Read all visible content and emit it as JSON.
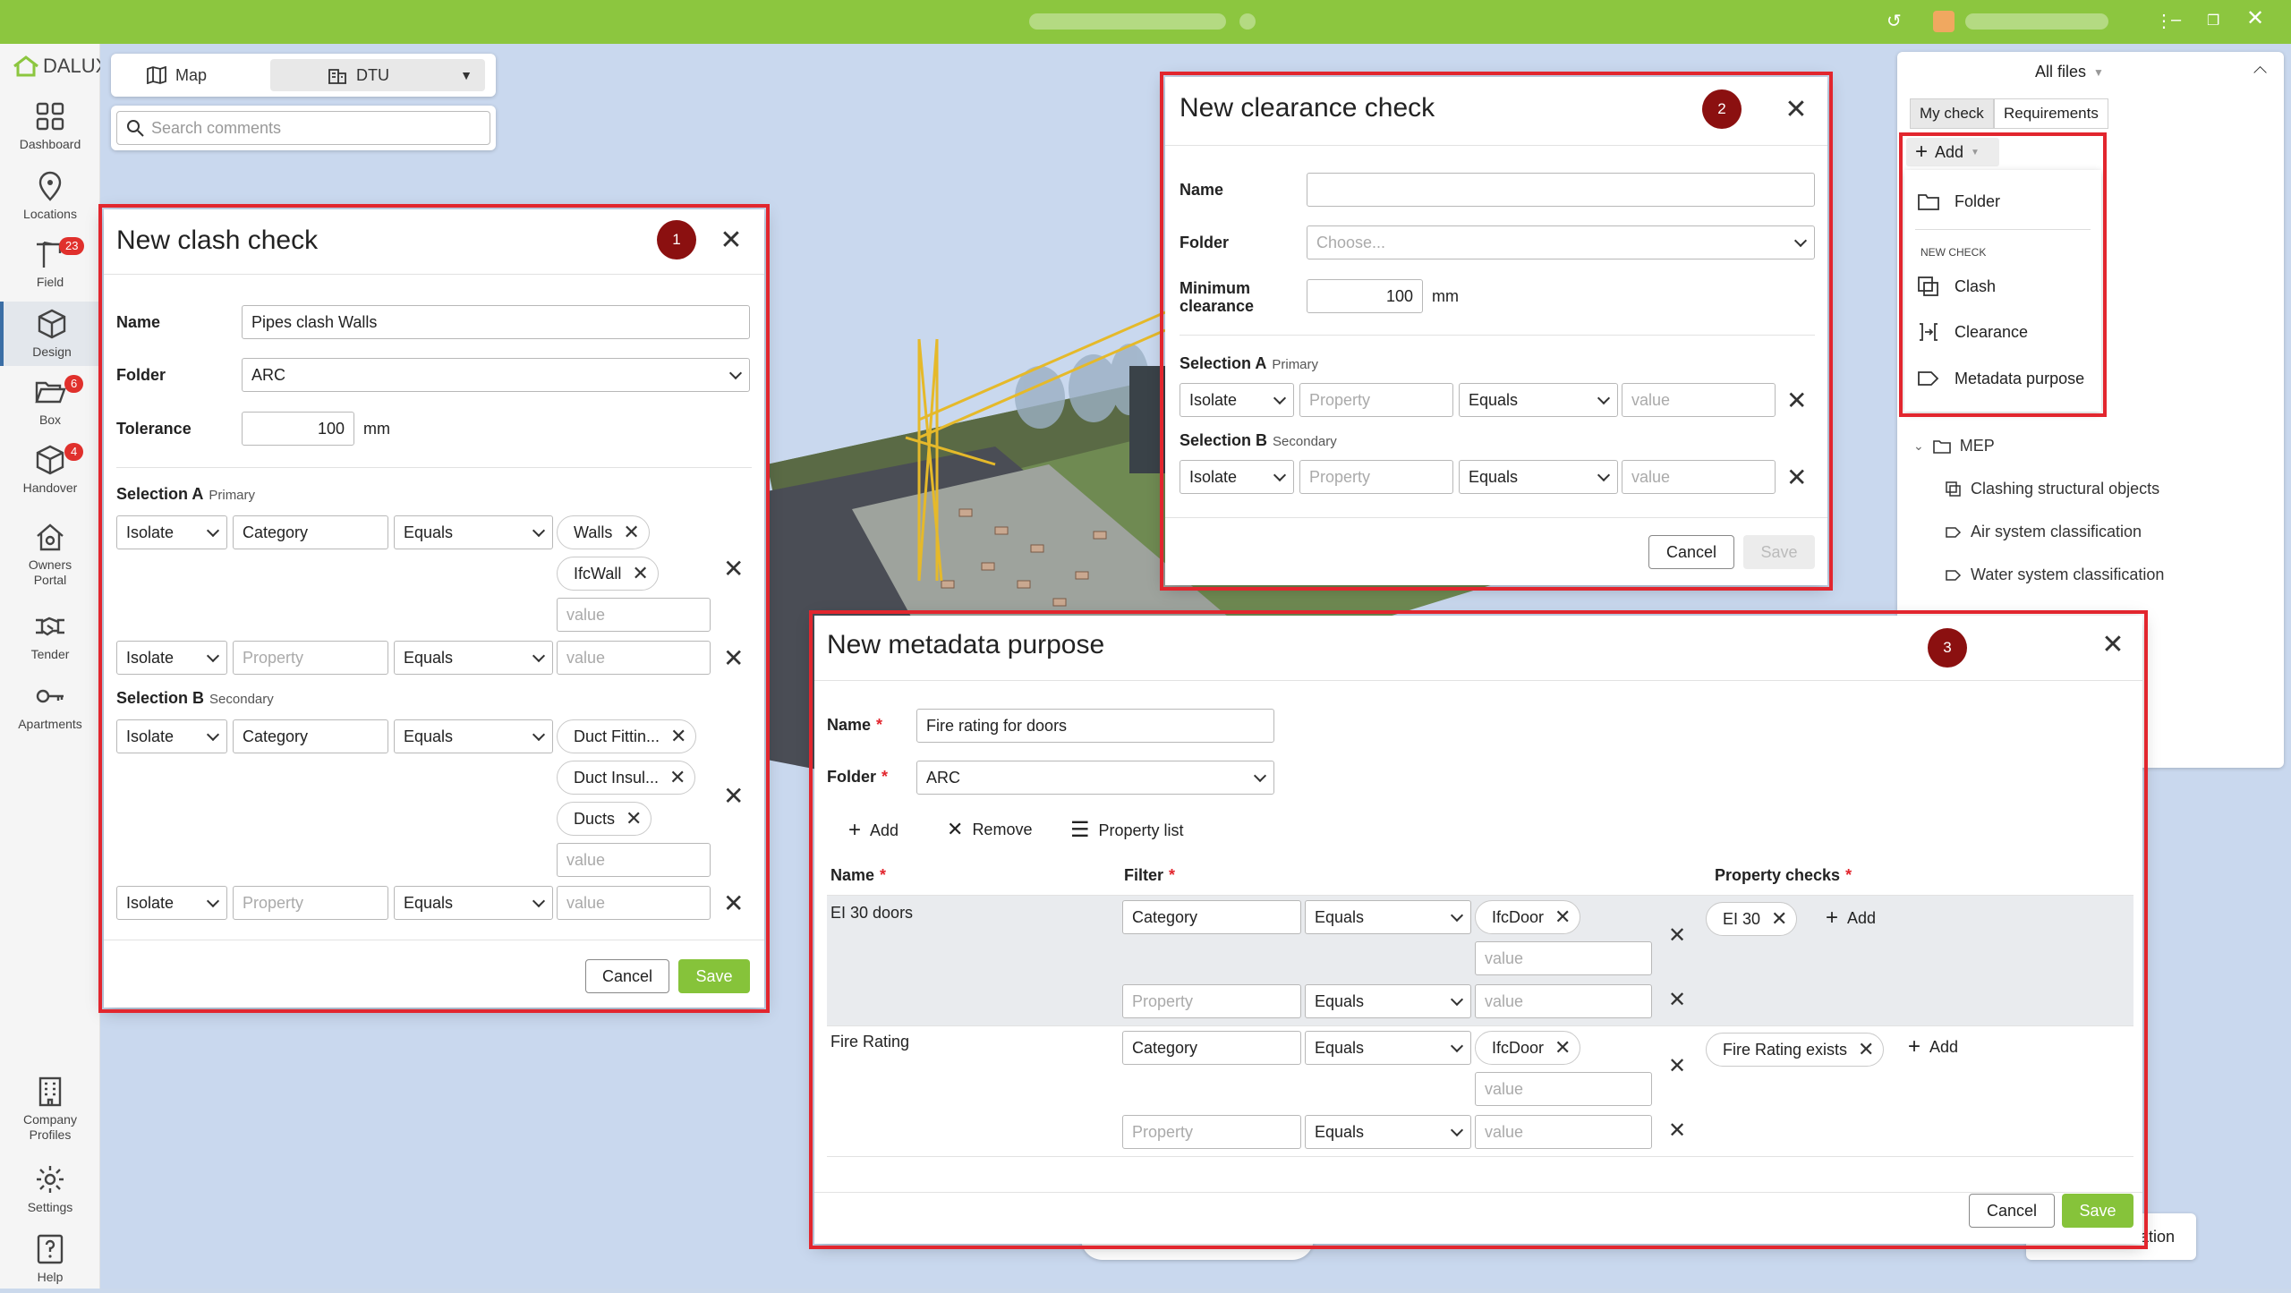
{
  "nav": {
    "logo": "DALUX",
    "items": [
      {
        "label": "Dashboard"
      },
      {
        "label": "Locations"
      },
      {
        "label": "Field",
        "badge": "23"
      },
      {
        "label": "Design"
      },
      {
        "label": "Box",
        "badge": "6"
      },
      {
        "label": "Handover",
        "badge": "4"
      },
      {
        "label": "Owners Portal"
      },
      {
        "label": "Tender"
      },
      {
        "label": "Apartments"
      },
      {
        "label": "Company Profiles"
      },
      {
        "label": "Settings"
      },
      {
        "label": "Help"
      }
    ]
  },
  "toolbar": {
    "map_label": "Map",
    "model_label": "DTU",
    "search_placeholder": "Search comments"
  },
  "rightpanel": {
    "files_label": "All files",
    "tabs": [
      "My check",
      "Requirements"
    ],
    "add_label": "Add",
    "menu": {
      "folder": "Folder",
      "section": "NEW CHECK",
      "clash": "Clash",
      "clearance": "Clearance",
      "metadata": "Metadata purpose"
    },
    "tree": {
      "folder": "MEP",
      "items": [
        "Clashing structural objects",
        "Air system classification",
        "Water system classification"
      ]
    },
    "validation_label": "validation"
  },
  "clash": {
    "title": "New clash check",
    "number": "1",
    "name_label": "Name",
    "name_value": "Pipes clash Walls",
    "folder_label": "Folder",
    "folder_value": "ARC",
    "tolerance_label": "Tolerance",
    "tolerance_value": "100",
    "unit": "mm",
    "selA_label": "Selection A",
    "selA_sub": "Primary",
    "selB_label": "Selection B",
    "selB_sub": "Secondary",
    "isolate": "Isolate",
    "category": "Category",
    "property_ph": "Property",
    "equals": "Equals",
    "value_ph": "value",
    "chipsA": [
      "Walls",
      "IfcWall"
    ],
    "chipsB": [
      "Duct Fittin...",
      "Duct Insul...",
      "Ducts"
    ],
    "cancel": "Cancel",
    "save": "Save"
  },
  "clearance": {
    "title": "New clearance check",
    "number": "2",
    "name_label": "Name",
    "folder_label": "Folder",
    "folder_ph": "Choose...",
    "min_label_1": "Minimum",
    "min_label_2": "clearance",
    "min_value": "100",
    "unit": "mm",
    "selA_label": "Selection A",
    "selA_sub": "Primary",
    "selB_label": "Selection B",
    "selB_sub": "Secondary",
    "isolate": "Isolate",
    "property_ph": "Property",
    "equals": "Equals",
    "value_ph": "value",
    "cancel": "Cancel",
    "save": "Save"
  },
  "metadata": {
    "title": "New metadata purpose",
    "number": "3",
    "name_label": "Name",
    "name_value": "Fire rating for doors",
    "folder_label": "Folder",
    "folder_value": "ARC",
    "add": "Add",
    "remove": "Remove",
    "property_list": "Property list",
    "col_name": "Name",
    "col_filter": "Filter",
    "col_checks": "Property checks",
    "category": "Category",
    "property_ph": "Property",
    "equals": "Equals",
    "value_ph": "value",
    "rows": [
      {
        "name": "EI 30 doors",
        "filter_chip": "IfcDoor",
        "check_chip": "EI 30",
        "add": "Add"
      },
      {
        "name": "Fire Rating",
        "filter_chip": "IfcDoor",
        "check_chip": "Fire Rating exists",
        "add": "Add"
      }
    ],
    "cancel": "Cancel",
    "save": "Save"
  },
  "colors": {
    "titlebar": "#8cc63f",
    "accent_save": "#86c33a",
    "frame": "#e2262e",
    "number_badge": "#8b1010",
    "badge": "#e0302c"
  }
}
